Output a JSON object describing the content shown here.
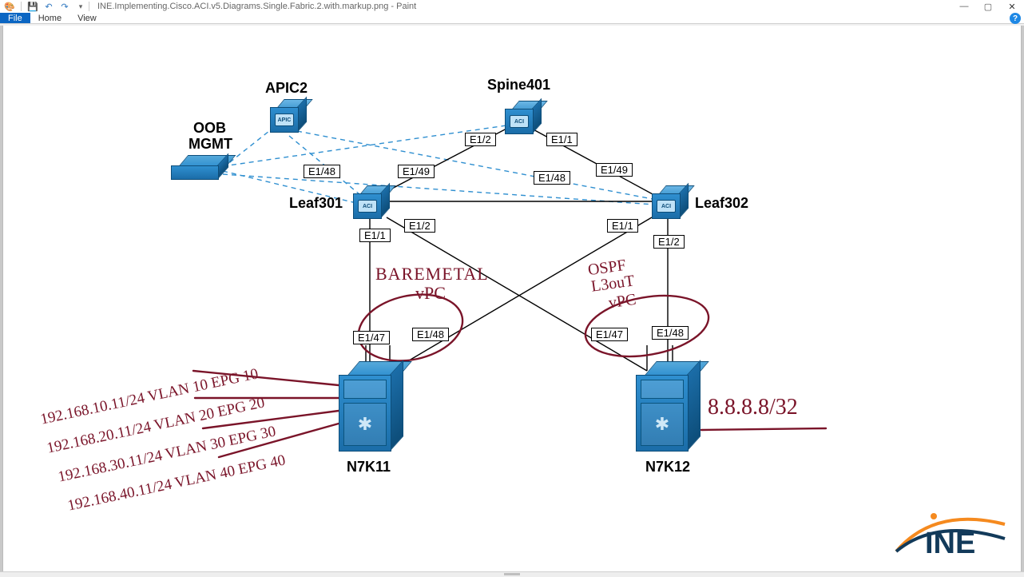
{
  "window": {
    "title": "INE.Implementing.Cisco.ACI.v5.Diagrams.Single.Fabric.2.with.markup.png - Paint",
    "help_glyph": "?"
  },
  "ribbon": {
    "tabs": {
      "file": "File",
      "home": "Home",
      "view": "View"
    }
  },
  "nodes": {
    "apic2": "APIC2",
    "spine401": "Spine401",
    "oob_line1": "OOB",
    "oob_line2": "MGMT",
    "leaf301": "Leaf301",
    "leaf302": "Leaf302",
    "n7k11": "N7K11",
    "n7k12": "N7K12"
  },
  "ports": {
    "spine_e12": "E1/2",
    "spine_e11": "E1/1",
    "leaf301_e148": "E1/48",
    "leaf301_e149": "E1/49",
    "leaf302_e148": "E1/48",
    "leaf302_e149": "E1/49",
    "leaf301_dn_e11": "E1/1",
    "leaf301_dn_e12": "E1/2",
    "leaf302_dn_e11": "E1/1",
    "leaf302_dn_e12": "E1/2",
    "n7k11_e147": "E1/47",
    "n7k11_e148": "E1/48",
    "n7k12_e147": "E1/47",
    "n7k12_e148": "E1/48"
  },
  "markup": {
    "baremetal": "BAREMETAL",
    "vpc_left": "vPC",
    "ospf": "OSPF",
    "l3out": "L3ouT",
    "vpc_right": "vPC",
    "route": "8.8.8.8/32",
    "row1": "192.168.10.11/24 VLAN 10 EPG 10",
    "row2": "192.168.20.11/24 VLAN 20 EPG 20",
    "row3": "192.168.30.11/24 VLAN 30 EPG 30",
    "row4": "192.168.40.11/24 VLAN 40 EPG 40"
  },
  "brand": {
    "name": "INE"
  },
  "colors": {
    "device_blue": "#2f8fd0",
    "markup_red": "#7a1429",
    "file_tab_blue": "#0b66c3",
    "brand_blue": "#123a5a",
    "brand_orange": "#f58a1f"
  }
}
